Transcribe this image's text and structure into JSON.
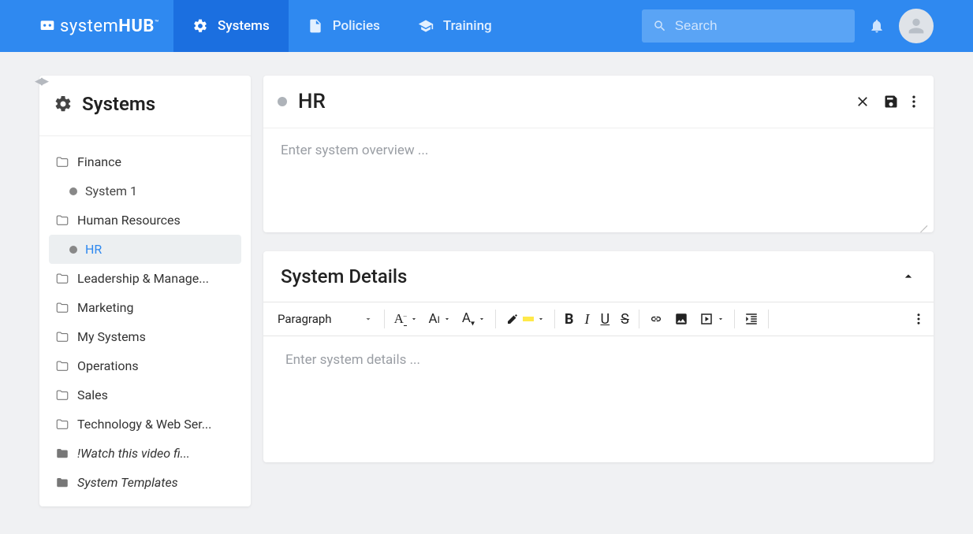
{
  "brand": {
    "name_a": "system",
    "name_b": "HUB"
  },
  "nav": {
    "systems": "Systems",
    "policies": "Policies",
    "training": "Training"
  },
  "search": {
    "placeholder": "Search"
  },
  "sidebar": {
    "title": "Systems",
    "items": [
      {
        "label": "Finance",
        "type": "folder-outline"
      },
      {
        "label": "Human Resources",
        "type": "folder-outline"
      },
      {
        "label": "Leadership & Manage...",
        "type": "folder-outline"
      },
      {
        "label": "Marketing",
        "type": "folder-outline"
      },
      {
        "label": "My Systems",
        "type": "folder-outline"
      },
      {
        "label": "Operations",
        "type": "folder-outline"
      },
      {
        "label": "Sales",
        "type": "folder-outline"
      },
      {
        "label": "Technology & Web Ser...",
        "type": "folder-outline"
      },
      {
        "label": "!Watch this video fi...",
        "type": "folder-solid",
        "italic": true
      },
      {
        "label": "System Templates",
        "type": "folder-solid",
        "italic": true
      }
    ],
    "children": {
      "finance": [
        {
          "label": "System 1"
        }
      ],
      "hr": [
        {
          "label": "HR",
          "selected": true
        }
      ]
    }
  },
  "editor": {
    "title": "HR",
    "overview_placeholder": "Enter system overview ...",
    "details_title": "System Details",
    "details_placeholder": "Enter system details ...",
    "paragraph": "Paragraph"
  }
}
